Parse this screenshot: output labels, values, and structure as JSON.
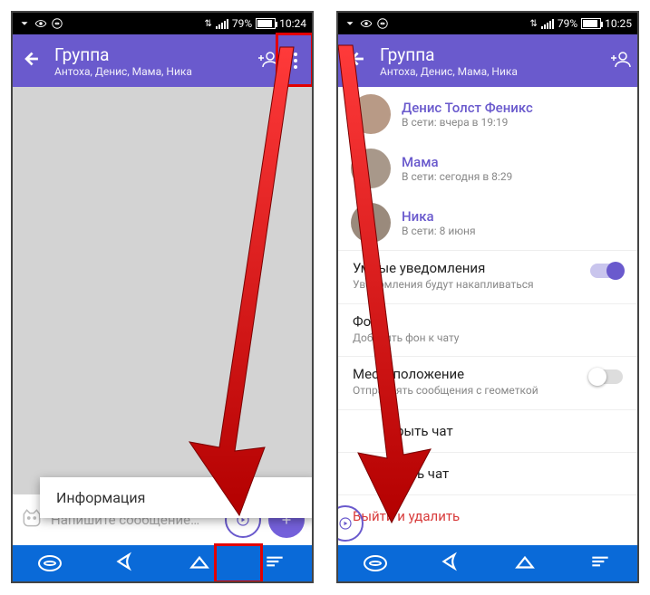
{
  "left": {
    "status": {
      "battery_pct": "79%",
      "time": "10:24"
    },
    "header": {
      "title": "Группа",
      "subtitle": "Антоха, Денис, Мама, Ника"
    },
    "input_placeholder": "Напишите сообщение…",
    "popup_item": "Информация"
  },
  "right": {
    "status": {
      "battery_pct": "79%",
      "time": "10:25"
    },
    "header": {
      "title": "Группа",
      "subtitle": "Антоха, Денис, Мама, Ника"
    },
    "members": [
      {
        "name": "Денис Толст Феникс",
        "status": "В сети: вчера в 19:19"
      },
      {
        "name": "Мама",
        "status": "В сети: сегодня в 8:29"
      },
      {
        "name": "Ника",
        "status": "В сети: 8 июня"
      }
    ],
    "settings": {
      "smart_notif_title": "Умные уведомления",
      "smart_notif_sub": "Уведомления будут накапливаться",
      "bg_title": "Фон",
      "bg_sub": "Добавить фон к чату",
      "loc_title": "Местоположение",
      "loc_sub": "Отправлять сообщения с геометкой"
    },
    "actions": {
      "hide_chat": "крыть чат",
      "clear_chat": "стить чат",
      "leave_delete": "Выйти и удалить"
    }
  }
}
